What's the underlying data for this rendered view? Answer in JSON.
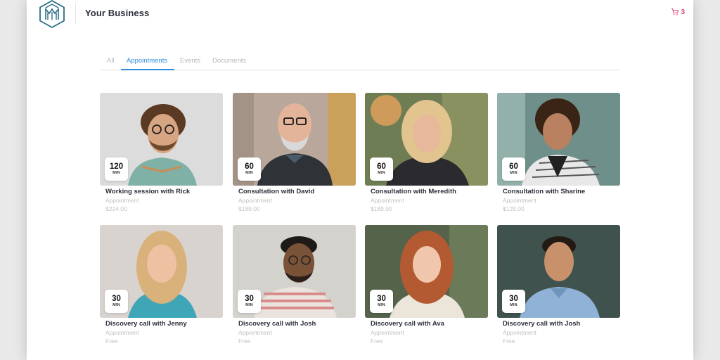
{
  "header": {
    "brand": "Your Business",
    "cart_count": "3"
  },
  "colors": {
    "accent": "#2f8ee0",
    "cart": "#e0457b",
    "logo": "#2a6e86"
  },
  "tabs": [
    {
      "label": "All",
      "active": false
    },
    {
      "label": "Appointments",
      "active": true
    },
    {
      "label": "Events",
      "active": false
    },
    {
      "label": "Documents",
      "active": false
    }
  ],
  "duration_unit": "MIN",
  "cards": [
    {
      "title": "Working session with Rick",
      "type": "Appointment",
      "price": "$224.00",
      "duration": "120"
    },
    {
      "title": "Consultation with David",
      "type": "Appointment",
      "price": "$189.00",
      "duration": "60"
    },
    {
      "title": "Consultation with Meredith",
      "type": "Appointment",
      "price": "$189.00",
      "duration": "60"
    },
    {
      "title": "Consultation with Sharine",
      "type": "Appointment",
      "price": "$129.00",
      "duration": "60"
    },
    {
      "title": "Discovery call with Jenny",
      "type": "Appointment",
      "price": "Free",
      "duration": "30"
    },
    {
      "title": "Discovery call with Josh",
      "type": "Appointment",
      "price": "Free",
      "duration": "30"
    },
    {
      "title": "Discovery call with Ava",
      "type": "Appointment",
      "price": "Free",
      "duration": "30"
    },
    {
      "title": "Discovery call with Josh",
      "type": "Appointment",
      "price": "Free",
      "duration": "30"
    }
  ]
}
